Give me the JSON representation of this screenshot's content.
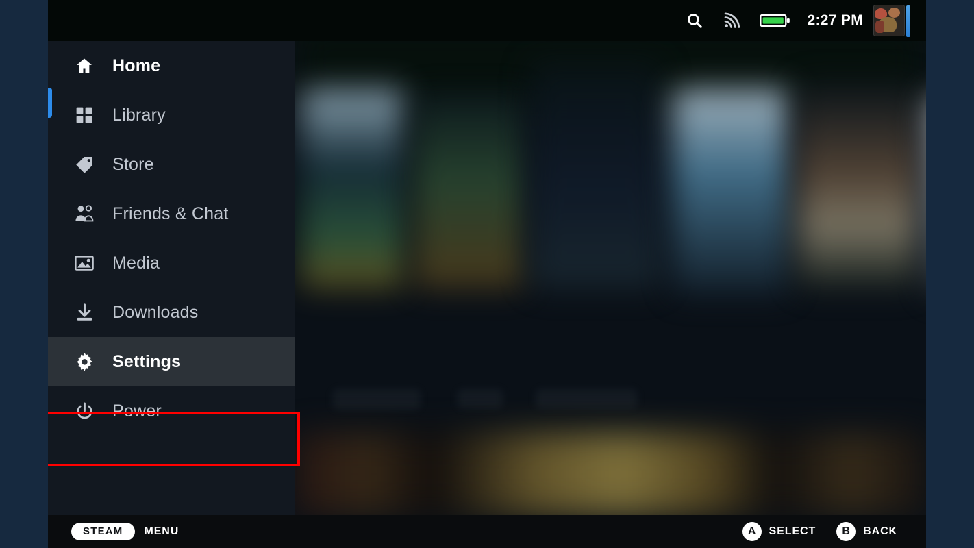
{
  "theme": {
    "frame_bg": "#16293f",
    "screen_bg": "#0b0f13",
    "topbar_bg": "#030806",
    "sidebar_bg": "#121820",
    "selected_row_bg": "#2c3238",
    "accent_blue": "#2d8ceb",
    "annotation_red": "#ff0000",
    "text_primary": "#ffffff",
    "text_secondary": "#c2c8d1",
    "battery_green": "#36d14a"
  },
  "statusbar": {
    "search_icon": "search-icon",
    "wifi_icon": "wifi-signal-icon",
    "battery_icon": "battery-full-icon",
    "clock": "2:27 PM",
    "avatar_icon": "user-avatar"
  },
  "sidebar": {
    "items": [
      {
        "label": "Home",
        "icon": "home-icon",
        "state": "focused"
      },
      {
        "label": "Library",
        "icon": "grid-icon",
        "state": "normal"
      },
      {
        "label": "Store",
        "icon": "tag-icon",
        "state": "normal"
      },
      {
        "label": "Friends & Chat",
        "icon": "people-icon",
        "state": "normal"
      },
      {
        "label": "Media",
        "icon": "image-icon",
        "state": "normal"
      },
      {
        "label": "Downloads",
        "icon": "download-icon",
        "state": "normal"
      },
      {
        "label": "Settings",
        "icon": "gear-icon",
        "state": "selected"
      },
      {
        "label": "Power",
        "icon": "power-icon",
        "state": "normal"
      }
    ]
  },
  "annotation": {
    "target": "Settings",
    "shape": "rectangle",
    "color": "#ff0000"
  },
  "footer": {
    "steam_badge": "STEAM",
    "menu_label": "MENU",
    "hints": [
      {
        "glyph": "A",
        "label": "SELECT"
      },
      {
        "glyph": "B",
        "label": "BACK"
      }
    ]
  }
}
